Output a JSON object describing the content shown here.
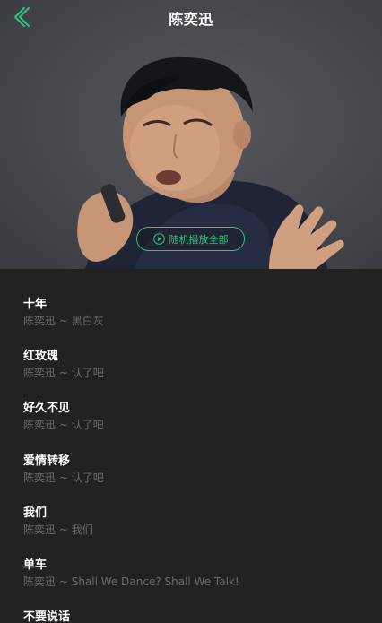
{
  "header": {
    "title": "陈奕迅",
    "back_icon": "chevron-left-icon"
  },
  "hero": {
    "shuffle_label": "随机播放全部",
    "shuffle_icon": "play-circle-icon",
    "accent_color": "#31c27c"
  },
  "songs": [
    {
      "name": "十年",
      "artist": "陈奕迅",
      "separator": "~",
      "album": "黑白灰"
    },
    {
      "name": "红玫瑰",
      "artist": "陈奕迅",
      "separator": "~",
      "album": "认了吧"
    },
    {
      "name": "好久不见",
      "artist": "陈奕迅",
      "separator": "~",
      "album": "认了吧"
    },
    {
      "name": "爱情转移",
      "artist": "陈奕迅",
      "separator": "~",
      "album": "认了吧"
    },
    {
      "name": "我们",
      "artist": "陈奕迅",
      "separator": "~",
      "album": "我们"
    },
    {
      "name": "单车",
      "artist": "陈奕迅",
      "separator": "~",
      "album": "Shall We Dance? Shall We Talk!"
    },
    {
      "name": "不要说话",
      "artist": "",
      "separator": "",
      "album": ""
    }
  ]
}
